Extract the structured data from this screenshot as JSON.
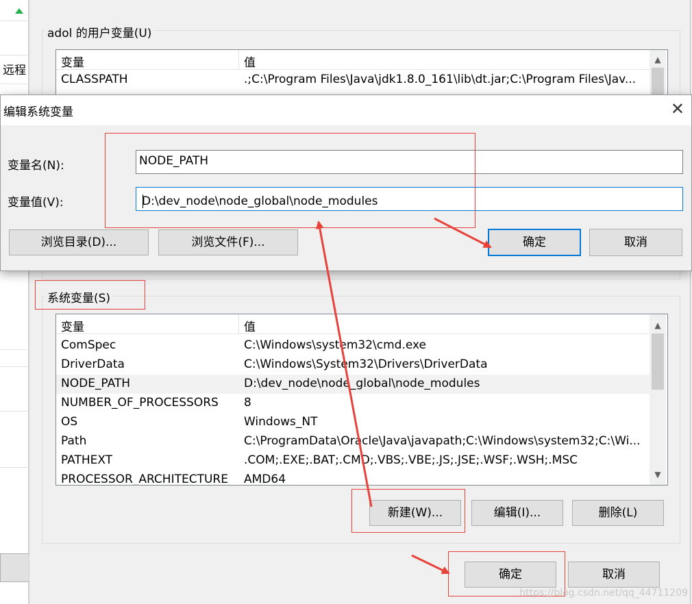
{
  "background_window": {
    "label": "远程"
  },
  "env_dialog": {
    "user_vars_group_title": "adol 的用户变量(U)",
    "user_vars": {
      "columns": [
        "变量",
        "值"
      ],
      "rows": [
        {
          "name": "CLASSPATH",
          "value": ".;C:\\Program Files\\Java\\jdk1.8.0_161\\lib\\dt.jar;C:\\Program Files\\Jav..."
        }
      ]
    },
    "system_vars_group_title": "系统变量(S)",
    "system_vars": {
      "columns": [
        "变量",
        "值"
      ],
      "rows": [
        {
          "name": "ComSpec",
          "value": "C:\\Windows\\system32\\cmd.exe"
        },
        {
          "name": "DriverData",
          "value": "C:\\Windows\\System32\\Drivers\\DriverData"
        },
        {
          "name": "NODE_PATH",
          "value": "D:\\dev_node\\node_global\\node_modules"
        },
        {
          "name": "NUMBER_OF_PROCESSORS",
          "value": "8"
        },
        {
          "name": "OS",
          "value": "Windows_NT"
        },
        {
          "name": "Path",
          "value": "C:\\ProgramData\\Oracle\\Java\\javapath;C:\\Windows\\system32;C:\\Wi..."
        },
        {
          "name": "PATHEXT",
          "value": ".COM;.EXE;.BAT;.CMD;.VBS;.VBE;.JS;.JSE;.WSF;.WSH;.MSC"
        },
        {
          "name": "PROCESSOR_ARCHITECTURE",
          "value": "AMD64"
        }
      ],
      "selected_row": 2
    },
    "buttons": {
      "new": "新建(W)...",
      "edit": "编辑(I)...",
      "delete": "删除(L)",
      "ok": "确定",
      "cancel": "取消"
    }
  },
  "edit_dialog": {
    "title": "编辑系统变量",
    "close_icon": "close-icon",
    "name_label": "变量名(N):",
    "name_value": "NODE_PATH",
    "value_label": "变量值(V):",
    "value_value": "D:\\dev_node\\node_global\\node_modules",
    "buttons": {
      "browse_dir": "浏览目录(D)...",
      "browse_file": "浏览文件(F)...",
      "ok": "确定",
      "cancel": "取消"
    }
  },
  "annotation_color": "#e8413a",
  "accent_color": "#0078d7",
  "watermark": "https://blog.csdn.net/qq_44711209"
}
